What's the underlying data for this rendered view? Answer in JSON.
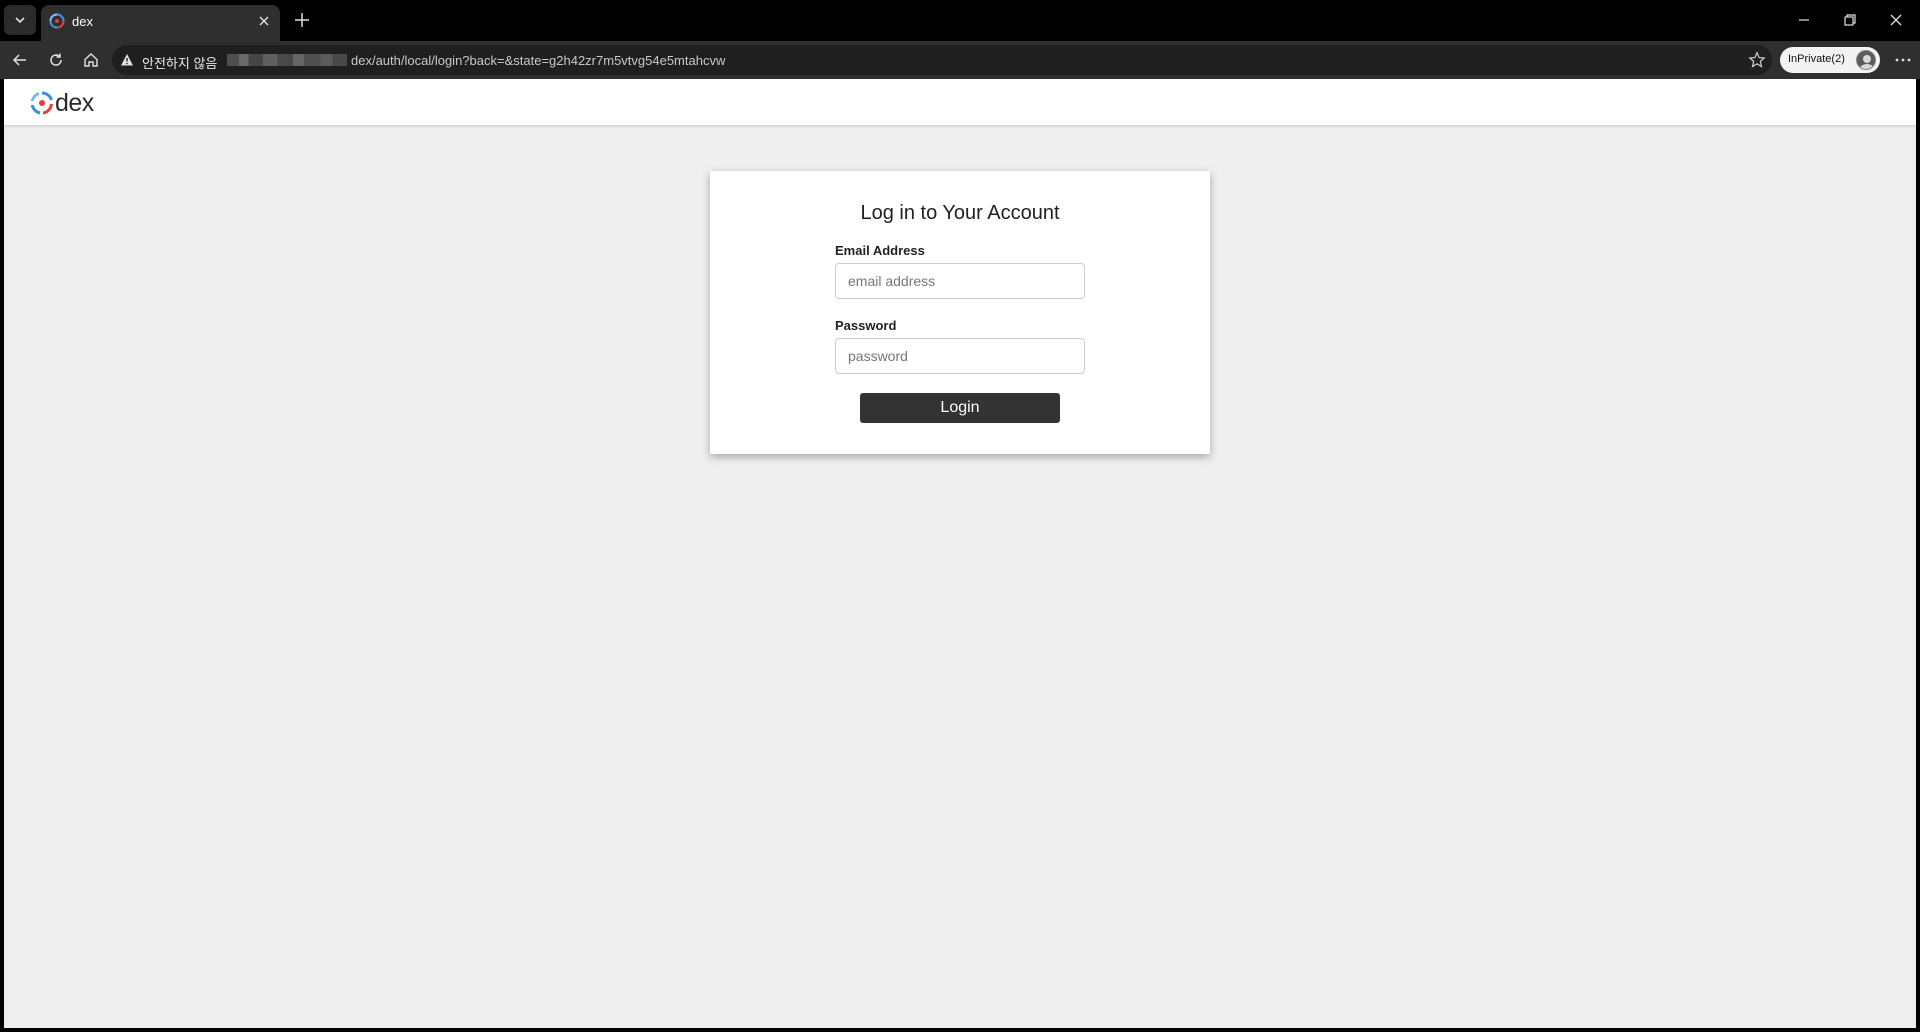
{
  "tab": {
    "title": "dex"
  },
  "omnibox": {
    "security_label": "안전하지 않음",
    "url_path": "dex/auth/local/login?back=&state=g2h42zr7m5vtvg54e5mtahcvw"
  },
  "profile": {
    "label": "InPrivate(2)"
  },
  "site": {
    "logo_text": "dex"
  },
  "login": {
    "heading": "Log in to Your Account",
    "email_label": "Email Address",
    "email_placeholder": "email address",
    "password_label": "Password",
    "password_placeholder": "password",
    "submit_label": "Login"
  }
}
